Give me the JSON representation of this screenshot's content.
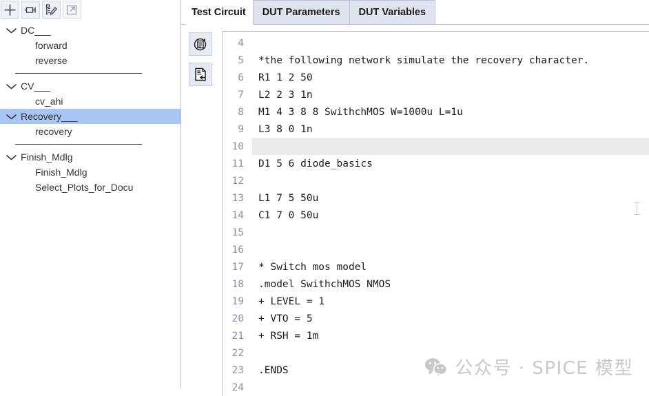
{
  "sidebar": {
    "toolbar": [
      {
        "name": "add-button",
        "icon": "plus-icon",
        "label": "+"
      },
      {
        "name": "rename-button",
        "icon": "rename-node-icon",
        "label": ""
      },
      {
        "name": "edit-button",
        "icon": "edit-pencil-icon",
        "label": ""
      },
      {
        "name": "open-external-button",
        "icon": "external-link-icon",
        "label": ""
      }
    ],
    "tree": [
      {
        "type": "group",
        "label": "DC___",
        "expanded": true,
        "selected": false
      },
      {
        "type": "child",
        "label": "forward",
        "selected": false
      },
      {
        "type": "child",
        "label": "reverse",
        "selected": false
      },
      {
        "type": "separator"
      },
      {
        "type": "group",
        "label": "CV___",
        "expanded": true,
        "selected": false
      },
      {
        "type": "child",
        "label": "cv_ahi",
        "selected": false
      },
      {
        "type": "group",
        "label": "Recovery___",
        "expanded": true,
        "selected": true
      },
      {
        "type": "child",
        "label": "recovery",
        "selected": false
      },
      {
        "type": "separator"
      },
      {
        "type": "group",
        "label": "Finish_Mdlg",
        "expanded": true,
        "selected": false
      },
      {
        "type": "child",
        "label": "Finish_Mdlg",
        "selected": false
      },
      {
        "type": "child",
        "label": "Select_Plots_for_Docu",
        "selected": false
      }
    ]
  },
  "tabs": [
    {
      "label": "Test Circuit",
      "active": true
    },
    {
      "label": "DUT Parameters",
      "active": false
    },
    {
      "label": "DUT Variables",
      "active": false
    }
  ],
  "editor": {
    "side_buttons": [
      {
        "name": "reload-netlist-button",
        "icon": "document-refresh-icon"
      },
      {
        "name": "import-netlist-button",
        "icon": "document-import-icon"
      }
    ],
    "active_line": 10,
    "lines": [
      {
        "n": "4",
        "text": ""
      },
      {
        "n": "5",
        "text": "*the following network simulate the recovery character."
      },
      {
        "n": "6",
        "text": "R1 1 2 50"
      },
      {
        "n": "7",
        "text": "L2 2 3 1n"
      },
      {
        "n": "8",
        "text": "M1 4 3 8 8 SwithchMOS W=1000u L=1u"
      },
      {
        "n": "9",
        "text": "L3 8 0 1n"
      },
      {
        "n": "10",
        "text": ""
      },
      {
        "n": "11",
        "text": "D1 5 6 diode_basics"
      },
      {
        "n": "12",
        "text": ""
      },
      {
        "n": "13",
        "text": "L1 7 5 50u"
      },
      {
        "n": "14",
        "text": "C1 7 0 50u"
      },
      {
        "n": "15",
        "text": ""
      },
      {
        "n": "16",
        "text": ""
      },
      {
        "n": "17",
        "text": "* Switch mos model"
      },
      {
        "n": "18",
        "text": ".model SwithchMOS NMOS"
      },
      {
        "n": "19",
        "text": "+ LEVEL = 1"
      },
      {
        "n": "20",
        "text": "+ VTO = 5"
      },
      {
        "n": "21",
        "text": "+ RSH = 1m"
      },
      {
        "n": "22",
        "text": ""
      },
      {
        "n": "23",
        "text": ".ENDS"
      },
      {
        "n": "24",
        "text": ""
      }
    ]
  },
  "watermark": {
    "text": "公众号 · SPICE 模型",
    "icon": "wechat-icon"
  },
  "colors": {
    "selection": "#a8c5f5",
    "active_line": "#ebebeb",
    "tab_inactive": "#dfe3ef",
    "border": "#b9c0cc",
    "gutter_text": "#8a90a8"
  }
}
